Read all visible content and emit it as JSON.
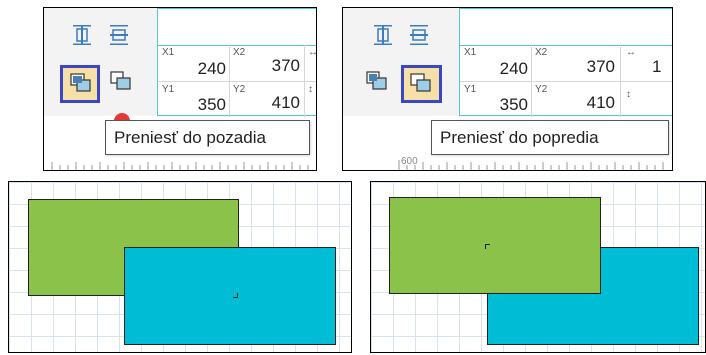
{
  "panels": {
    "left": {
      "tooltip": "Preniesť do pozadia",
      "coords": {
        "x1_label": "X1",
        "x1": "240",
        "x2_label": "X2",
        "x2": "370",
        "y1_label": "Y1",
        "y1": "350",
        "y2_label": "Y2",
        "y2": "410"
      },
      "ruler": []
    },
    "right": {
      "tooltip": "Preniesť do popredia",
      "coords": {
        "x1_label": "X1",
        "x1": "240",
        "x2_label": "X2",
        "x2": "370",
        "y1_label": "Y1",
        "y1": "350",
        "y2_label": "Y2",
        "y2": "410"
      },
      "ruler": [
        "600"
      ]
    }
  },
  "colors": {
    "green": "#8bc34a",
    "cyan": "#00bcd4",
    "selected_bg": "#f7dfa8",
    "selected_border": "#3a46c4"
  },
  "icons": [
    "align-center-horizontal-icon",
    "align-center-vertical-icon",
    "send-to-back-icon",
    "bring-to-front-icon"
  ]
}
